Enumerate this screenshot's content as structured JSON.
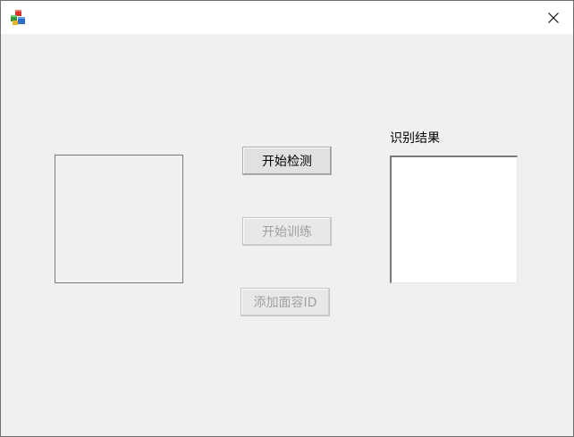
{
  "window": {
    "title": ""
  },
  "main": {
    "buttons": {
      "start_detect": "开始检测",
      "start_train": "开始训练",
      "add_face_id": "添加面容ID"
    },
    "result": {
      "label": "识别结果"
    }
  },
  "icons": {
    "app": "app-cube-icon",
    "close": "close-icon"
  }
}
